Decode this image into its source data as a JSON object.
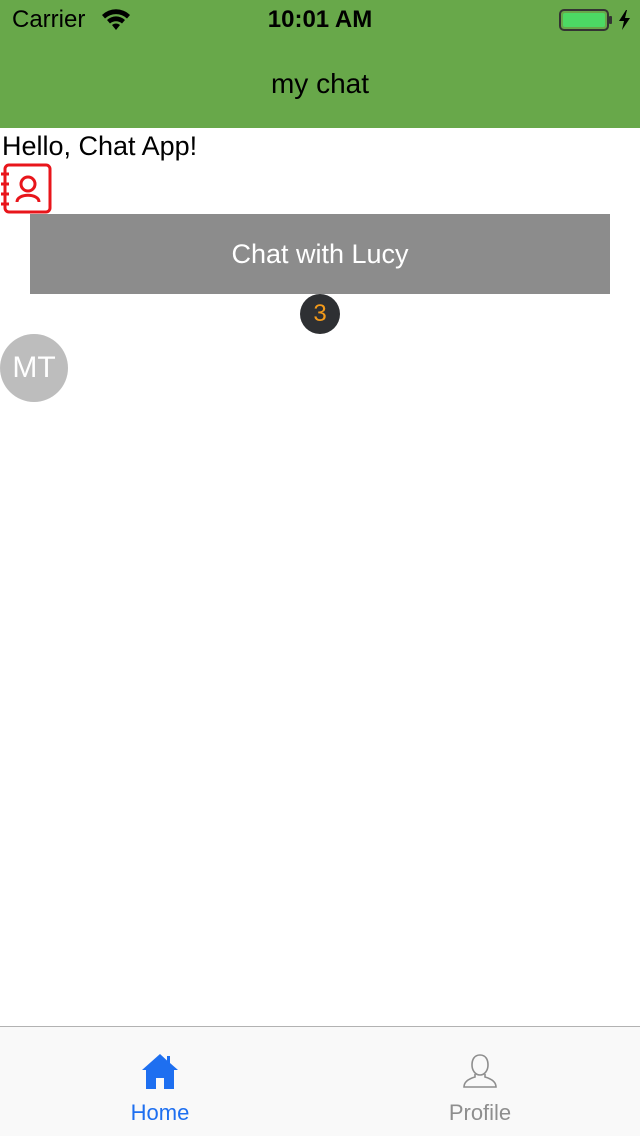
{
  "status_bar": {
    "carrier": "Carrier",
    "time": "10:01 AM",
    "wifi_icon": "wifi-icon",
    "battery_icon": "battery-charging-icon",
    "battery_level_percent": 100
  },
  "nav_bar": {
    "title": "my chat",
    "background_color": "#68a84a"
  },
  "main": {
    "greeting": "Hello, Chat App!",
    "contacts_icon": "contacts-book-icon",
    "chat_button_label": "Chat with Lucy",
    "unread_count": "3",
    "avatar_initials": "MT"
  },
  "tab_bar": {
    "tabs": [
      {
        "label": "Home",
        "icon": "home-icon",
        "active": true,
        "color": "#1e6ff0"
      },
      {
        "label": "Profile",
        "icon": "user-icon",
        "active": false,
        "color": "#8e8e8e"
      }
    ]
  }
}
